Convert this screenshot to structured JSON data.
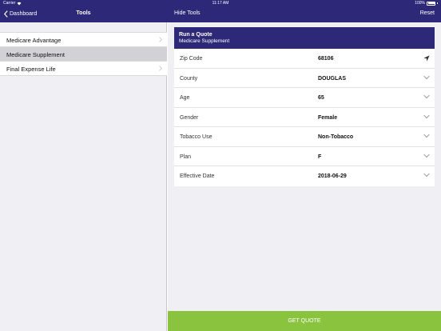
{
  "status_bar": {
    "carrier": "Carrier",
    "time": "11:17 AM",
    "battery": "100%"
  },
  "nav": {
    "back_label": "Dashboard",
    "title": "Tools",
    "hide_tools_label": "Hide Tools",
    "reset_label": "Reset"
  },
  "sidebar": {
    "items": [
      {
        "label": "Medicare Advantage",
        "selected": false
      },
      {
        "label": "Medicare Supplement",
        "selected": true
      },
      {
        "label": "Final Expense Life",
        "selected": false
      }
    ]
  },
  "quote": {
    "title": "Run a Quote",
    "subtitle": "Medicare Supplement",
    "fields": [
      {
        "label": "Zip Code",
        "value": "68106",
        "icon": "location-arrow-icon"
      },
      {
        "label": "County",
        "value": "DOUGLAS",
        "icon": "chevron-down-icon"
      },
      {
        "label": "Age",
        "value": "65",
        "icon": "chevron-down-icon"
      },
      {
        "label": "Gender",
        "value": "Female",
        "icon": "chevron-down-icon"
      },
      {
        "label": "Tobacco Use",
        "value": "Non-Tobacco",
        "icon": "chevron-down-icon"
      },
      {
        "label": "Plan",
        "value": "F",
        "icon": "chevron-down-icon"
      },
      {
        "label": "Effective Date",
        "value": "2018-06-29",
        "icon": "chevron-down-icon"
      }
    ],
    "button_label": "GET QUOTE"
  },
  "colors": {
    "brand": "#2e2878",
    "button": "#8ac43f",
    "background": "#efeff4"
  }
}
